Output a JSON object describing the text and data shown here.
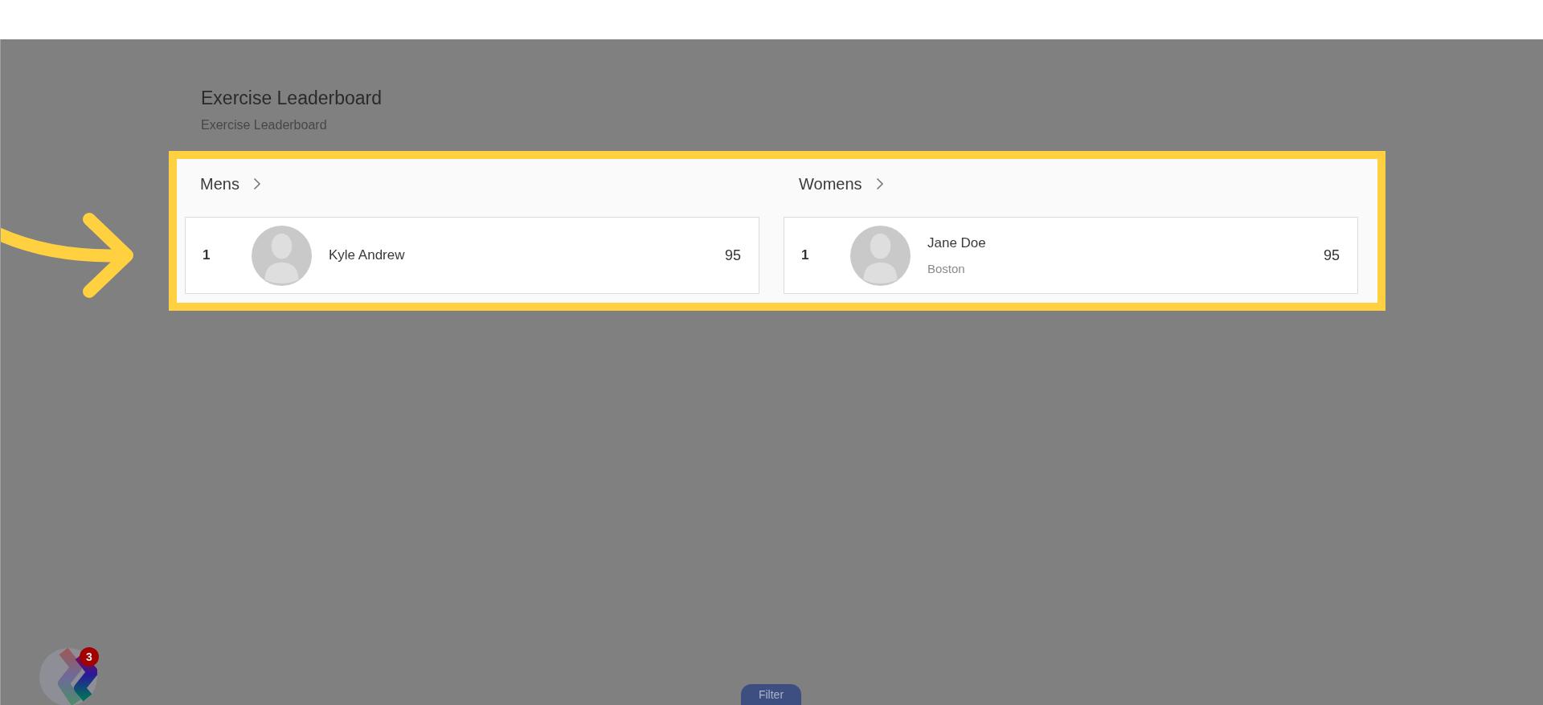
{
  "page": {
    "title": "Exercise Leaderboard",
    "subtitle": "Exercise Leaderboard"
  },
  "leaderboards": [
    {
      "heading": "Mens",
      "entries": [
        {
          "rank": "1",
          "name": "Kyle Andrew",
          "score": "95"
        }
      ]
    },
    {
      "heading": "Womens",
      "entries": [
        {
          "rank": "1",
          "name": "Jane Doe",
          "location": "Boston",
          "score": "95"
        }
      ]
    }
  ],
  "launcher": {
    "badge": "3"
  },
  "filter_button": {
    "label": "Filter"
  }
}
